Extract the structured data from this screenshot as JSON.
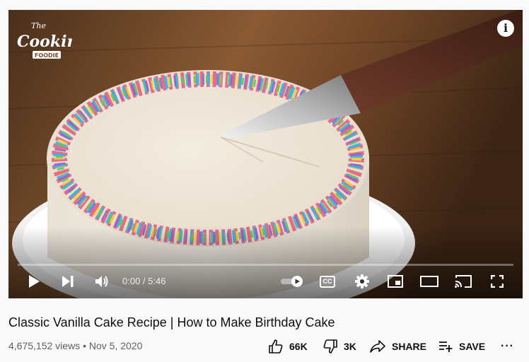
{
  "player": {
    "current_time": "0:00",
    "duration": "5:46",
    "time_separator": " / ",
    "progress": 0.0,
    "info_glyph": "i",
    "cc_label": "CC",
    "logo_line1": "The",
    "logo_line2": "Cooking",
    "logo_line3": "FOODIE",
    "icons": [
      "play-icon",
      "next-icon",
      "volume-icon",
      "autoplay-toggle",
      "subtitles-icon",
      "settings-icon",
      "miniplayer-icon",
      "theater-icon",
      "cast-icon",
      "fullscreen-icon"
    ]
  },
  "video": {
    "title": "Classic Vanilla Cake Recipe | How to Make Birthday Cake",
    "views": "4,675,152 views",
    "separator": " • ",
    "date": "Nov 5, 2020"
  },
  "actions": {
    "like_count": "66K",
    "dislike_count": "3K",
    "share_label": "SHARE",
    "save_label": "SAVE",
    "more_label": "···"
  },
  "colors": {
    "page_bg": "#f9f9f9",
    "text_primary": "#0f0f0f",
    "text_secondary": "#606060",
    "control_white": "#ffffff"
  }
}
